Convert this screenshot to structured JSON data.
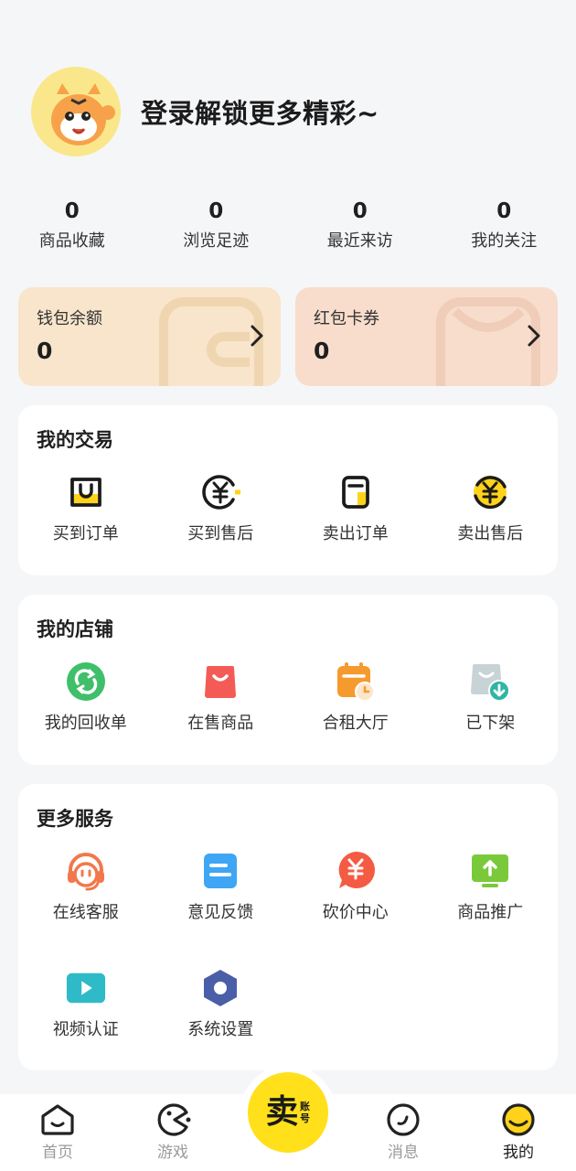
{
  "profile": {
    "login_text": "登录解锁更多精彩~"
  },
  "stats": [
    {
      "value": "0",
      "label": "商品收藏"
    },
    {
      "value": "0",
      "label": "浏览足迹"
    },
    {
      "value": "0",
      "label": "最近来访"
    },
    {
      "value": "0",
      "label": "我的关注"
    }
  ],
  "wallet": {
    "balance": {
      "title": "钱包余额",
      "value": "0"
    },
    "coupons": {
      "title": "红包卡券",
      "value": "0"
    }
  },
  "trade": {
    "title": "我的交易",
    "items": [
      {
        "label": "买到订单",
        "icon": "bought-order-icon"
      },
      {
        "label": "买到售后",
        "icon": "bought-aftersale-icon"
      },
      {
        "label": "卖出订单",
        "icon": "sold-order-icon"
      },
      {
        "label": "卖出售后",
        "icon": "sold-aftersale-icon"
      }
    ]
  },
  "shop": {
    "title": "我的店铺",
    "items": [
      {
        "label": "我的回收单",
        "icon": "recycle-icon"
      },
      {
        "label": "在售商品",
        "icon": "bag-icon"
      },
      {
        "label": "合租大厅",
        "icon": "calendar-clock-icon"
      },
      {
        "label": "已下架",
        "icon": "download-bag-icon"
      }
    ]
  },
  "services": {
    "title": "更多服务",
    "items": [
      {
        "label": "在线客服",
        "icon": "headset-icon"
      },
      {
        "label": "意见反馈",
        "icon": "feedback-icon"
      },
      {
        "label": "砍价中心",
        "icon": "yuan-tag-icon"
      },
      {
        "label": "商品推广",
        "icon": "promote-icon"
      },
      {
        "label": "视频认证",
        "icon": "video-icon"
      },
      {
        "label": "系统设置",
        "icon": "settings-icon"
      }
    ]
  },
  "nav": {
    "home": "首页",
    "games": "游戏",
    "sell_main": "卖",
    "sell_sub": "账号",
    "messages": "消息",
    "mine": "我的"
  },
  "colors": {
    "accent_yellow": "#ffe01b",
    "wallet_bg_1": "#f8e5cb",
    "wallet_bg_2": "#f8ddcc",
    "page_bg": "#f5f6f8"
  }
}
